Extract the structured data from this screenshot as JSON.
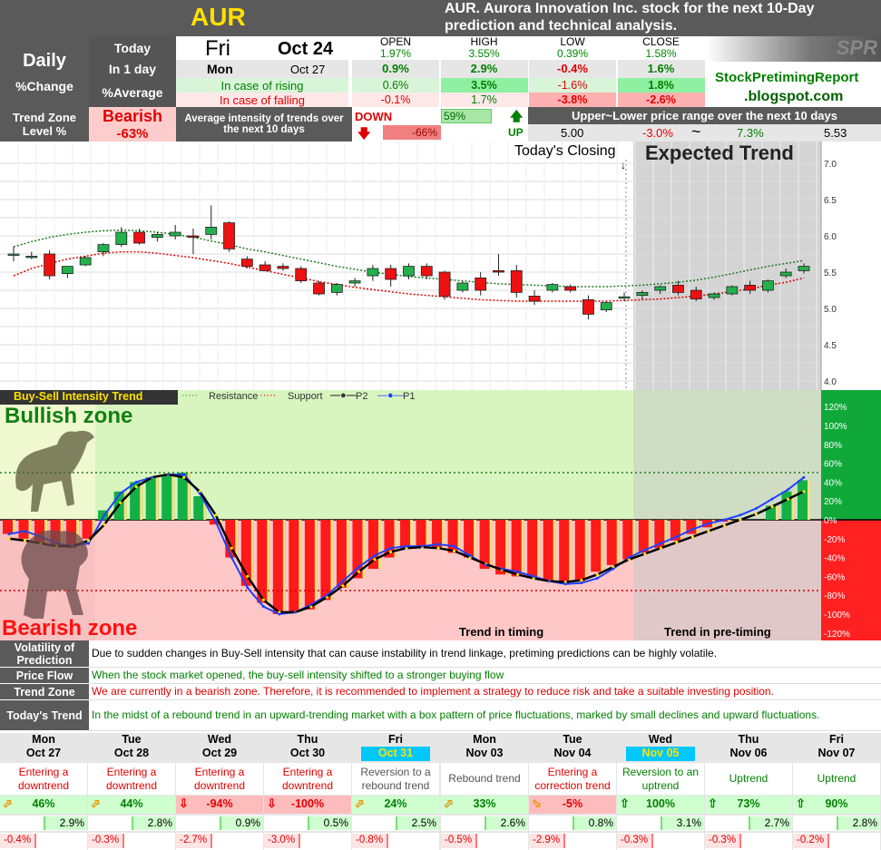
{
  "header": {
    "ticker": "AUR",
    "desc_line1": "AUR. Aurora Innovation Inc.  stock for the next 10-Day",
    "desc_line2": "prediction and technical analysis.",
    "logo": "SPR",
    "blog_line1": "StockPretimingReport",
    "blog_line2": ".blogspot.com"
  },
  "summary": {
    "daily": "Daily",
    "pct_change": "%Change",
    "today_label": "Today",
    "today_day": "Fri",
    "today_date": "Oct 24",
    "in1day_label": "In 1 day",
    "in1day_day": "Mon",
    "in1day_date": "Oct 27",
    "avg_label": "%Average",
    "rising_label": "In case of rising",
    "falling_label": "In case of falling",
    "cols": [
      "OPEN",
      "HIGH",
      "LOW",
      "CLOSE"
    ],
    "today_vals": [
      "1.97%",
      "3.55%",
      "0.39%",
      "1.58%"
    ],
    "in1day_vals": [
      "0.9%",
      "2.9%",
      "-0.4%",
      "1.6%"
    ],
    "rising_vals": [
      "0.6%",
      "3.5%",
      "-1.6%",
      "1.8%"
    ],
    "falling_vals": [
      "-0.1%",
      "1.7%",
      "-3.8%",
      "-2.6%"
    ]
  },
  "trendzone": {
    "label1": "Trend Zone",
    "label2": "Level %",
    "state": "Bearish",
    "level": "-63%",
    "avg_label1": "Average intensity of trends over",
    "avg_label2": "the next 10 days",
    "down_label": "DOWN",
    "down_val": "-66%",
    "up_label": "UP",
    "up_val": "59%",
    "range_label": "Upper~Lower price range over the next 10 days",
    "range_low": "5.00",
    "range_low_pct": "-3.0%",
    "range_sep": "~",
    "range_high_pct": "7.3%",
    "range_high": "5.53"
  },
  "chart_data": [
    {
      "type": "candlestick",
      "title": "",
      "annotations": [
        "Today's Closing",
        "Expected Trend"
      ],
      "ylim": [
        4.0,
        7.0
      ],
      "yticks": [
        "7.0",
        "6.5",
        "6.0",
        "5.5",
        "5.0",
        "4.5",
        "4.0"
      ],
      "candles": [
        {
          "o": 5.75,
          "h": 5.85,
          "l": 5.65,
          "c": 5.75
        },
        {
          "o": 5.72,
          "h": 5.78,
          "l": 5.68,
          "c": 5.72
        },
        {
          "o": 5.75,
          "h": 5.8,
          "l": 5.4,
          "c": 5.45
        },
        {
          "o": 5.48,
          "h": 5.58,
          "l": 5.42,
          "c": 5.58
        },
        {
          "o": 5.6,
          "h": 5.72,
          "l": 5.58,
          "c": 5.7
        },
        {
          "o": 5.78,
          "h": 5.9,
          "l": 5.72,
          "c": 5.88
        },
        {
          "o": 5.88,
          "h": 6.12,
          "l": 5.85,
          "c": 6.05
        },
        {
          "o": 6.05,
          "h": 6.1,
          "l": 5.88,
          "c": 5.9
        },
        {
          "o": 5.98,
          "h": 6.05,
          "l": 5.92,
          "c": 6.02
        },
        {
          "o": 6.0,
          "h": 6.15,
          "l": 5.95,
          "c": 6.05
        },
        {
          "o": 6.0,
          "h": 6.1,
          "l": 5.75,
          "c": 5.98
        },
        {
          "o": 6.02,
          "h": 6.42,
          "l": 5.95,
          "c": 6.12
        },
        {
          "o": 6.18,
          "h": 6.2,
          "l": 5.78,
          "c": 5.82
        },
        {
          "o": 5.68,
          "h": 5.72,
          "l": 5.55,
          "c": 5.58
        },
        {
          "o": 5.6,
          "h": 5.65,
          "l": 5.52,
          "c": 5.52
        },
        {
          "o": 5.58,
          "h": 5.62,
          "l": 5.52,
          "c": 5.55
        },
        {
          "o": 5.55,
          "h": 5.58,
          "l": 5.35,
          "c": 5.38
        },
        {
          "o": 5.35,
          "h": 5.38,
          "l": 5.18,
          "c": 5.2
        },
        {
          "o": 5.22,
          "h": 5.35,
          "l": 5.18,
          "c": 5.33
        },
        {
          "o": 5.35,
          "h": 5.42,
          "l": 5.3,
          "c": 5.38
        },
        {
          "o": 5.45,
          "h": 5.6,
          "l": 5.38,
          "c": 5.55
        },
        {
          "o": 5.55,
          "h": 5.6,
          "l": 5.3,
          "c": 5.4
        },
        {
          "o": 5.45,
          "h": 5.62,
          "l": 5.4,
          "c": 5.58
        },
        {
          "o": 5.58,
          "h": 5.62,
          "l": 5.4,
          "c": 5.45
        },
        {
          "o": 5.5,
          "h": 5.52,
          "l": 5.12,
          "c": 5.17
        },
        {
          "o": 5.25,
          "h": 5.38,
          "l": 5.22,
          "c": 5.35
        },
        {
          "o": 5.42,
          "h": 5.5,
          "l": 5.18,
          "c": 5.25
        },
        {
          "o": 5.52,
          "h": 5.75,
          "l": 5.45,
          "c": 5.5
        },
        {
          "o": 5.52,
          "h": 5.6,
          "l": 5.15,
          "c": 5.22
        },
        {
          "o": 5.17,
          "h": 5.25,
          "l": 5.05,
          "c": 5.1
        },
        {
          "o": 5.25,
          "h": 5.35,
          "l": 5.22,
          "c": 5.33
        },
        {
          "o": 5.3,
          "h": 5.33,
          "l": 5.22,
          "c": 5.25
        },
        {
          "o": 5.12,
          "h": 5.18,
          "l": 4.85,
          "c": 4.92
        },
        {
          "o": 4.98,
          "h": 5.1,
          "l": 4.95,
          "c": 5.08
        },
        {
          "o": 5.16,
          "h": 5.22,
          "l": 5.1,
          "c": 5.16
        },
        {
          "o": 5.18,
          "h": 5.25,
          "l": 5.12,
          "c": 5.22
        },
        {
          "o": 5.25,
          "h": 5.32,
          "l": 5.2,
          "c": 5.3
        },
        {
          "o": 5.32,
          "h": 5.38,
          "l": 5.18,
          "c": 5.22
        },
        {
          "o": 5.25,
          "h": 5.3,
          "l": 5.1,
          "c": 5.13
        },
        {
          "o": 5.15,
          "h": 5.22,
          "l": 5.12,
          "c": 5.2
        },
        {
          "o": 5.2,
          "h": 5.32,
          "l": 5.18,
          "c": 5.3
        },
        {
          "o": 5.32,
          "h": 5.38,
          "l": 5.2,
          "c": 5.25
        },
        {
          "o": 5.25,
          "h": 5.4,
          "l": 5.22,
          "c": 5.38
        },
        {
          "o": 5.45,
          "h": 5.55,
          "l": 5.42,
          "c": 5.5
        },
        {
          "o": 5.52,
          "h": 5.62,
          "l": 5.48,
          "c": 5.58
        }
      ],
      "resistance": [
        5.85,
        5.92,
        5.98,
        6.02,
        6.05,
        6.07,
        6.08,
        6.07,
        6.05,
        6.02,
        5.98,
        5.93,
        5.88,
        5.82,
        5.78,
        5.73,
        5.68,
        5.63,
        5.58,
        5.54,
        5.5,
        5.47,
        5.44,
        5.42,
        5.4,
        5.38,
        5.36,
        5.34,
        5.33,
        5.32,
        5.31,
        5.3,
        5.3,
        5.3,
        5.31,
        5.32,
        5.34,
        5.36,
        5.39,
        5.43,
        5.48,
        5.53,
        5.58,
        5.62,
        5.66
      ],
      "support": [
        5.45,
        5.55,
        5.62,
        5.68,
        5.72,
        5.76,
        5.78,
        5.78,
        5.76,
        5.73,
        5.7,
        5.66,
        5.62,
        5.57,
        5.52,
        5.47,
        5.42,
        5.37,
        5.33,
        5.29,
        5.26,
        5.23,
        5.2,
        5.18,
        5.16,
        5.14,
        5.12,
        5.11,
        5.1,
        5.1,
        5.1,
        5.1,
        5.1,
        5.1,
        5.11,
        5.12,
        5.13,
        5.15,
        5.17,
        5.2,
        5.23,
        5.27,
        5.32,
        5.36,
        5.42
      ]
    },
    {
      "type": "bar",
      "title": "Buy-Sell Intensity Trend",
      "legend": [
        "Resistance",
        "Support",
        "P2",
        "P1"
      ],
      "zones": [
        "Bullish zone",
        "Bearish zone"
      ],
      "labels": [
        "Trend in timing",
        "Trend in pre-timing"
      ],
      "ylim": [
        -120,
        120
      ],
      "yticks": [
        "120%",
        "100%",
        "80%",
        "60%",
        "40%",
        "20%",
        "0%",
        "-20%",
        "-40%",
        "-60%",
        "-80%",
        "-100%",
        "-120%"
      ],
      "resistance_level": 50,
      "support_level": -75,
      "bars": [
        -15,
        -20,
        -25,
        -28,
        -30,
        -20,
        10,
        30,
        40,
        45,
        48,
        50,
        25,
        -5,
        -40,
        -70,
        -88,
        -100,
        -98,
        -95,
        -85,
        -72,
        -62,
        -52,
        -40,
        -30,
        -28,
        -30,
        -35,
        -40,
        -52,
        -58,
        -60,
        -62,
        -65,
        -68,
        -65,
        -55,
        -48,
        -42,
        -35,
        -30,
        -22,
        -15,
        -8,
        -2,
        0,
        0,
        15,
        30,
        42
      ],
      "p1": [
        -15,
        -12,
        -18,
        -25,
        -28,
        -25,
        5,
        28,
        40,
        45,
        48,
        48,
        28,
        -2,
        -40,
        -72,
        -92,
        -100,
        -98,
        -90,
        -80,
        -65,
        -50,
        -38,
        -30,
        -28,
        -28,
        -26,
        -28,
        -38,
        -48,
        -52,
        -55,
        -60,
        -65,
        -68,
        -67,
        -62,
        -52,
        -40,
        -32,
        -25,
        -18,
        -10,
        -4,
        0,
        5,
        12,
        22,
        32,
        45
      ],
      "p2": [
        -20,
        -22,
        -25,
        -28,
        -28,
        -22,
        -5,
        18,
        35,
        45,
        48,
        45,
        30,
        5,
        -30,
        -60,
        -85,
        -98,
        -98,
        -92,
        -82,
        -70,
        -55,
        -42,
        -34,
        -30,
        -29,
        -30,
        -33,
        -40,
        -47,
        -53,
        -58,
        -62,
        -65,
        -66,
        -64,
        -58,
        -50,
        -42,
        -36,
        -30,
        -24,
        -18,
        -12,
        -6,
        0,
        6,
        14,
        22,
        30
      ]
    }
  ],
  "notes": [
    {
      "label": "Volatility of Prediction",
      "text": "Due to sudden changes in Buy-Sell intensity that can cause instability in trend linkage, pretiming predictions can be highly volatile.",
      "color": "#000000"
    },
    {
      "label": "Price Flow",
      "text": "When the stock market opened, the buy-sell intensity shifted to a stronger buying flow",
      "color": "#008000"
    },
    {
      "label": "Trend Zone",
      "text": "We are currently in a bearish zone. Therefore, it is recommended to implement a strategy to reduce risk and take a suitable investing position.",
      "color": "#e00000"
    },
    {
      "label": "Today's Trend",
      "text": "In the midst of a rebound trend in an upward-trending market with a box pattern of price fluctuations, marked by small declines and upward fluctuations.",
      "color": "#008000"
    }
  ],
  "forecast": [
    {
      "day": "Mon",
      "date": "Oct 27",
      "hl": false,
      "trend": "Entering a downtrend",
      "tcolor": "#e00000",
      "arrow": "up-right",
      "pct": "46%",
      "pos": true,
      "up": "2.9%",
      "down": "-0.4%"
    },
    {
      "day": "Tue",
      "date": "Oct 28",
      "hl": false,
      "trend": "Entering a downtrend",
      "tcolor": "#e00000",
      "arrow": "up-right",
      "pct": "44%",
      "pos": true,
      "up": "2.8%",
      "down": "-0.3%"
    },
    {
      "day": "Wed",
      "date": "Oct 29",
      "hl": false,
      "trend": "Entering a downtrend",
      "tcolor": "#e00000",
      "arrow": "down",
      "pct": "-94%",
      "pos": false,
      "up": "0.9%",
      "down": "-2.7%"
    },
    {
      "day": "Thu",
      "date": "Oct 30",
      "hl": false,
      "trend": "Entering a downtrend",
      "tcolor": "#e00000",
      "arrow": "down",
      "pct": "-100%",
      "pos": false,
      "up": "0.5%",
      "down": "-3.0%"
    },
    {
      "day": "Fri",
      "date": "Oct 31",
      "hl": true,
      "trend": "Reversion to a rebound trend",
      "tcolor": "#555555",
      "arrow": "up-right",
      "pct": "24%",
      "pos": true,
      "up": "2.5%",
      "down": "-0.8%"
    },
    {
      "day": "Mon",
      "date": "Nov 03",
      "hl": false,
      "trend": "Rebound trend",
      "tcolor": "#555555",
      "arrow": "up-right",
      "pct": "33%",
      "pos": true,
      "up": "2.6%",
      "down": "-0.5%"
    },
    {
      "day": "Tue",
      "date": "Nov 04",
      "hl": false,
      "trend": "Entering a correction trend",
      "tcolor": "#e00000",
      "arrow": "down-right",
      "pct": "-5%",
      "pos": false,
      "up": "0.8%",
      "down": "-2.9%"
    },
    {
      "day": "Wed",
      "date": "Nov 05",
      "hl": true,
      "trend": "Reversion to an uptrend",
      "tcolor": "#008000",
      "arrow": "up",
      "pct": "100%",
      "pos": true,
      "up": "3.1%",
      "down": "-0.3%"
    },
    {
      "day": "Thu",
      "date": "Nov 06",
      "hl": false,
      "trend": "Uptrend",
      "tcolor": "#008000",
      "arrow": "up",
      "pct": "73%",
      "pos": true,
      "up": "2.7%",
      "down": "-0.3%"
    },
    {
      "day": "Fri",
      "date": "Nov 07",
      "hl": false,
      "trend": "Uptrend",
      "tcolor": "#008000",
      "arrow": "up",
      "pct": "90%",
      "pos": true,
      "up": "2.8%",
      "down": "-0.2%"
    }
  ]
}
